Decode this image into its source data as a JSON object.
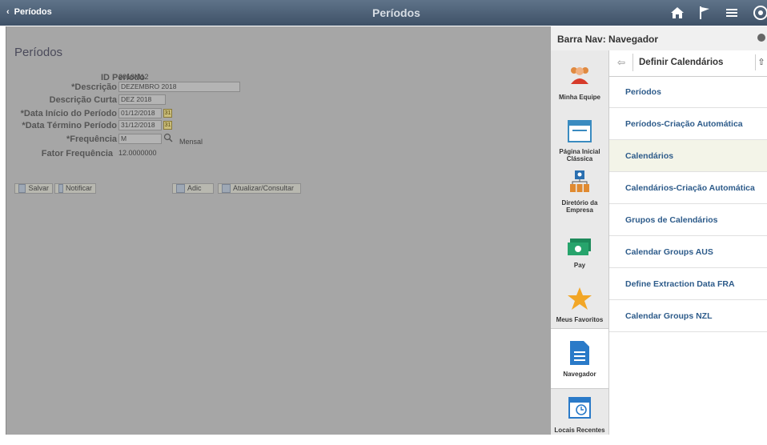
{
  "topbar": {
    "back_label": "Períodos",
    "title": "Períodos"
  },
  "page": {
    "title": "Períodos",
    "fields": {
      "id_label": "ID Período",
      "id_value": "2018M12",
      "desc_label": "*Descrição",
      "desc_value": "DEZEMBRO 2018",
      "short_label": "Descrição Curta",
      "short_value": "DEZ 2018",
      "start_label": "*Data Início do Período",
      "start_value": "01/12/2018",
      "end_label": "*Data Término Período",
      "end_value": "31/12/2018",
      "freq_label": "*Frequência",
      "freq_value": "M",
      "freq_desc": "Mensal",
      "factor_label": "Fator Frequência",
      "factor_value": "12.0000000"
    },
    "buttons": {
      "save": "Salvar",
      "notify": "Notificar",
      "add": "Adic",
      "update": "Atualizar/Consultar"
    }
  },
  "panel": {
    "title": "Barra Nav: Navegador",
    "rail": [
      {
        "label": "Minha Equipe",
        "icon": "team-icon"
      },
      {
        "label": "Página Inicial Clássica",
        "icon": "classic-home-icon"
      },
      {
        "label": "Diretório da Empresa",
        "icon": "directory-icon"
      },
      {
        "label": "Pay",
        "icon": "money-icon"
      },
      {
        "label": "Meus Favoritos",
        "icon": "star-icon"
      },
      {
        "label": "Navegador",
        "icon": "navigator-icon"
      },
      {
        "label": "Locais Recentes",
        "icon": "recent-icon"
      }
    ],
    "nav": {
      "header": "Definir Calendários",
      "items": [
        "Períodos",
        "Períodos-Criação Automática",
        "Calendários",
        "Calendários-Criação Automática",
        "Grupos de Calendários",
        "Calendar Groups AUS",
        "Define Extraction Data FRA",
        "Calendar Groups NZL"
      ]
    }
  },
  "colors": {
    "topbar": "#4a5d73",
    "overlay": "#a6a6a6",
    "link": "#2d5b8a",
    "selected_bg": "#f3f4e8",
    "accent_star": "#f2a626"
  }
}
